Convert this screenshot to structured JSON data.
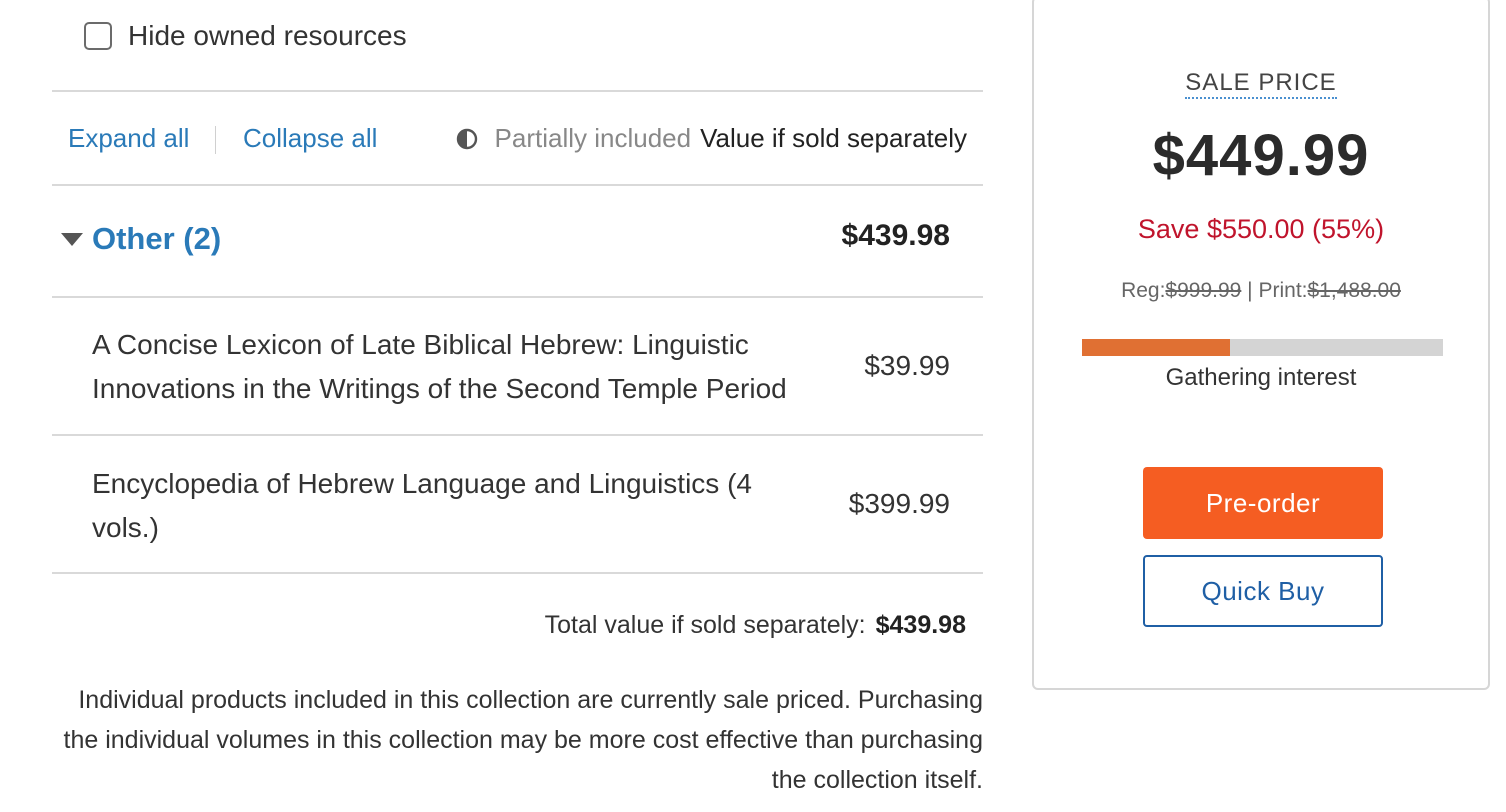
{
  "filters": {
    "hide_owned_label": "Hide owned resources",
    "hide_owned_checked": false
  },
  "toolbar": {
    "expand_all": "Expand all",
    "collapse_all": "Collapse all",
    "legend_partial": "Partially included",
    "legend_value": "Value if sold separately",
    "legend_icon": "half-circle-icon"
  },
  "group": {
    "title": "Other (2)",
    "total": "$439.98",
    "expanded": true,
    "items": [
      {
        "title": "A Concise Lexicon of Late Biblical Hebrew: Linguistic Innovations in the Writings of the Second Temple Period",
        "price": "$39.99"
      },
      {
        "title": "Encyclopedia of Hebrew Language and Linguistics (4 vols.)",
        "price": "$399.99"
      }
    ]
  },
  "summary": {
    "total_label": "Total value if sold separately:",
    "total_value": "$439.98",
    "disclaimer": "Individual products included in this collection are currently sale priced. Purchasing the individual volumes in this collection may be more cost effective than purchasing the collection itself."
  },
  "pricing": {
    "sale_label": "SALE PRICE",
    "sale_price": "$449.99",
    "save_text": "Save $550.00 (55%)",
    "reg_label": "Reg:",
    "reg_price": "$999.99",
    "separator": " | ",
    "print_label": "Print:",
    "print_price": "$1,488.00",
    "interest_progress": 0.41,
    "interest_label": "Gathering interest",
    "preorder_label": "Pre-order",
    "quickbuy_label": "Quick Buy"
  },
  "colors": {
    "link": "#2a7ab8",
    "save_red": "#c0142c",
    "preorder_orange": "#f55d22",
    "progress_fill": "#e07033",
    "quickbuy_blue": "#1f5fa5"
  }
}
